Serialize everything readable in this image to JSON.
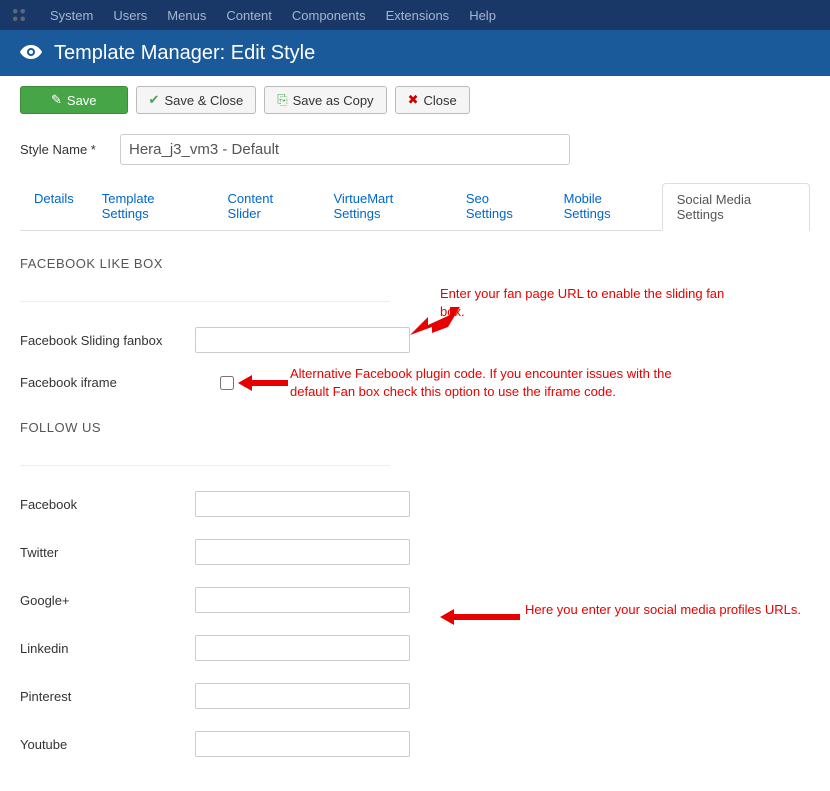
{
  "menubar": {
    "items": [
      "System",
      "Users",
      "Menus",
      "Content",
      "Components",
      "Extensions",
      "Help"
    ]
  },
  "page": {
    "title": "Template Manager: Edit Style"
  },
  "toolbar": {
    "save": "Save",
    "save_close": "Save & Close",
    "save_copy": "Save as Copy",
    "close": "Close"
  },
  "style_name": {
    "label": "Style Name *",
    "value": "Hera_j3_vm3 - Default"
  },
  "tabs": [
    {
      "label": "Details"
    },
    {
      "label": "Template Settings"
    },
    {
      "label": "Content Slider"
    },
    {
      "label": "VirtueMart Settings"
    },
    {
      "label": "Seo Settings"
    },
    {
      "label": "Mobile Settings"
    },
    {
      "label": "Social Media Settings",
      "active": true
    }
  ],
  "sections": {
    "fb_box": "FACEBOOK LIKE BOX",
    "follow": "FOLLOW US"
  },
  "fields": {
    "fb_fanbox": "Facebook Sliding fanbox",
    "fb_iframe": "Facebook iframe",
    "facebook": "Facebook",
    "twitter": "Twitter",
    "google": "Google+",
    "linkedin": "Linkedin",
    "pinterest": "Pinterest",
    "youtube": "Youtube"
  },
  "annotations": {
    "fanbox_note": "Enter your fan page URL to enable the sliding fan box.",
    "iframe_note": "Alternative Facebook plugin code. If you encounter issues with the default Fan box check this option to use the iframe code.",
    "profiles_note": "Here you enter your social media profiles URLs."
  }
}
